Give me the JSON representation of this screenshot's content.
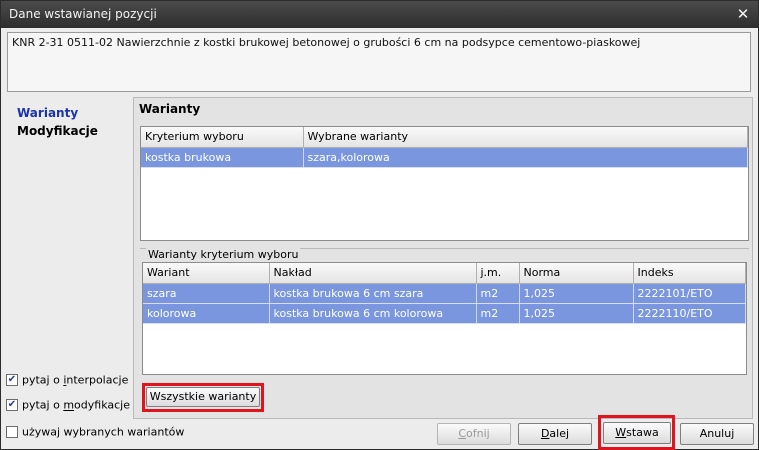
{
  "window": {
    "title": "Dane wstawianej pozycji"
  },
  "description": "KNR 2-31 0511-02 Nawierzchnie z kostki brukowej betonowej o grubości 6 cm na podsypce cementowo-piaskowej",
  "nav": [
    {
      "label": "Warianty"
    },
    {
      "label": "Modyfikacje"
    }
  ],
  "panel": {
    "title": "Warianty"
  },
  "criteria_table": {
    "headers": [
      "Kryterium wyboru",
      "Wybrane warianty"
    ],
    "rows": [
      [
        "kostka brukowa",
        "szara,kolorowa"
      ]
    ]
  },
  "variants_group": {
    "label": "Warianty kryterium wyboru",
    "headers": [
      "Wariant",
      "Nakład",
      "j.m.",
      "Norma",
      "Indeks"
    ],
    "rows": [
      [
        "szara",
        "kostka brukowa 6 cm szara",
        "m2",
        "1,025",
        "2222101/ETO"
      ],
      [
        "kolorowa",
        "kostka brukowa 6 cm kolorowa",
        "m2",
        "1,025",
        "2222110/ETO"
      ]
    ]
  },
  "all_variants_button": "Wszystkie warianty",
  "checkboxes": [
    {
      "pre": "pytaj o ",
      "key": "i",
      "post": "nterpolacje",
      "checked": true
    },
    {
      "pre": "pytaj o ",
      "key": "m",
      "post": "odyfikacje",
      "checked": true
    },
    {
      "pre": "używaj wybranych wariantów",
      "key": "",
      "post": "",
      "checked": false
    }
  ],
  "buttons": {
    "back": {
      "key": "C",
      "rest": "ofnij"
    },
    "next": {
      "key": "D",
      "rest": "alej"
    },
    "insert": {
      "key": "W",
      "rest": "stawa"
    },
    "cancel": {
      "label": "Anuluj"
    }
  },
  "colors": {
    "selection": "#7a96df",
    "highlight": "#e0141e",
    "active_nav": "#1a34a8"
  }
}
